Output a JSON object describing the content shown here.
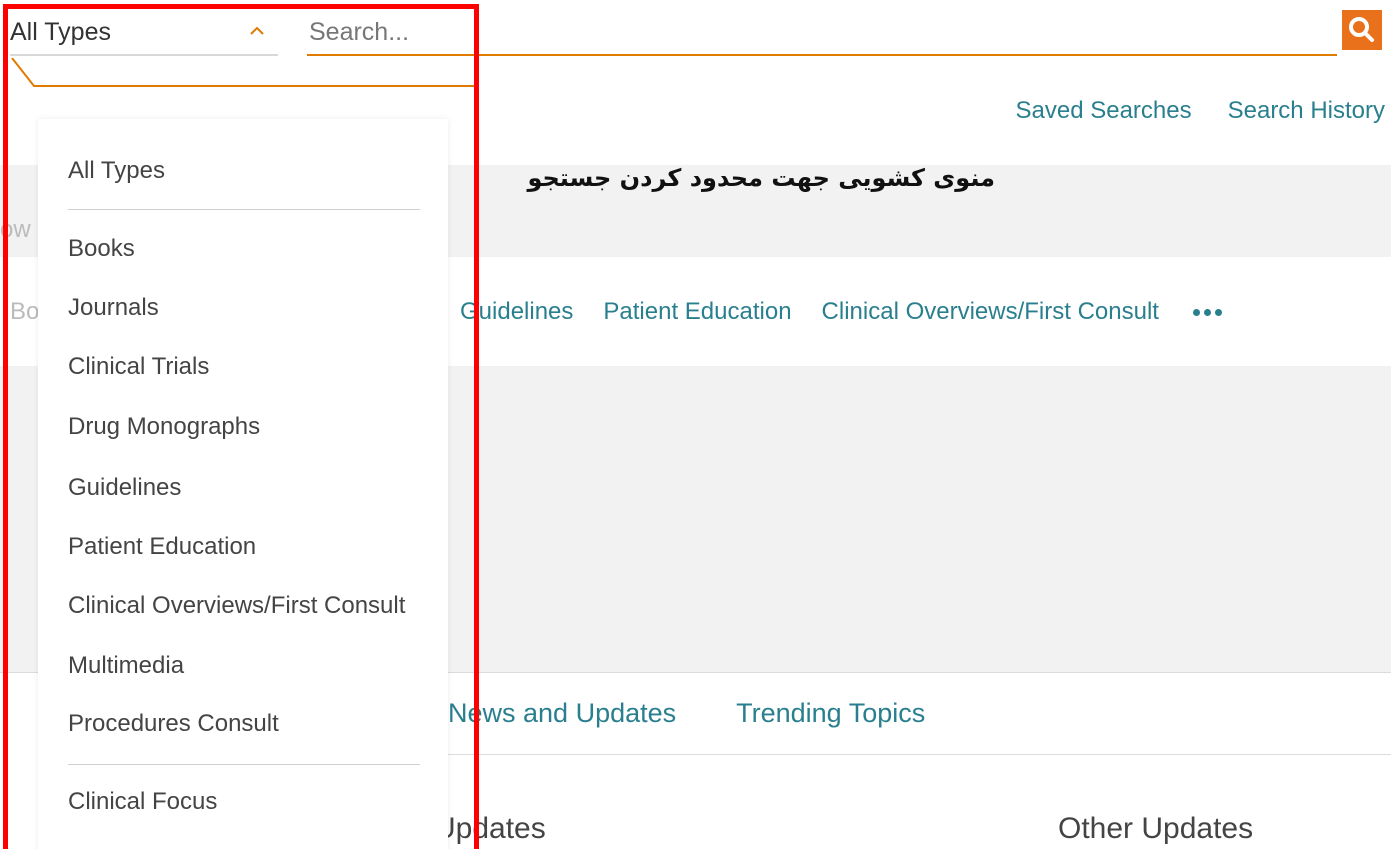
{
  "search": {
    "type_selected": "All Types",
    "placeholder": "Search..."
  },
  "top_links": [
    "Saved Searches",
    "Search History"
  ],
  "annotation": "منوی کشویی جهت محدود کردن جستجو",
  "partial_left": [
    "ow",
    "Bo"
  ],
  "type_links": [
    "Guidelines",
    "Patient Education",
    "Clinical Overviews/First Consult"
  ],
  "news_tabs": [
    "News and Updates",
    "Trending Topics"
  ],
  "sections": [
    "Updates",
    "Other Updates"
  ],
  "dropdown": {
    "items": [
      "All Types",
      "Books",
      "Journals",
      "Clinical Trials",
      "Drug Monographs",
      "Guidelines",
      "Patient Education",
      "Clinical Overviews/First Consult",
      "Multimedia",
      "Procedures Consult",
      "Clinical Focus"
    ]
  },
  "colors": {
    "accent_orange": "#e9711c",
    "link_teal": "#2a7f8e",
    "annotation_red": "#ff0000"
  }
}
